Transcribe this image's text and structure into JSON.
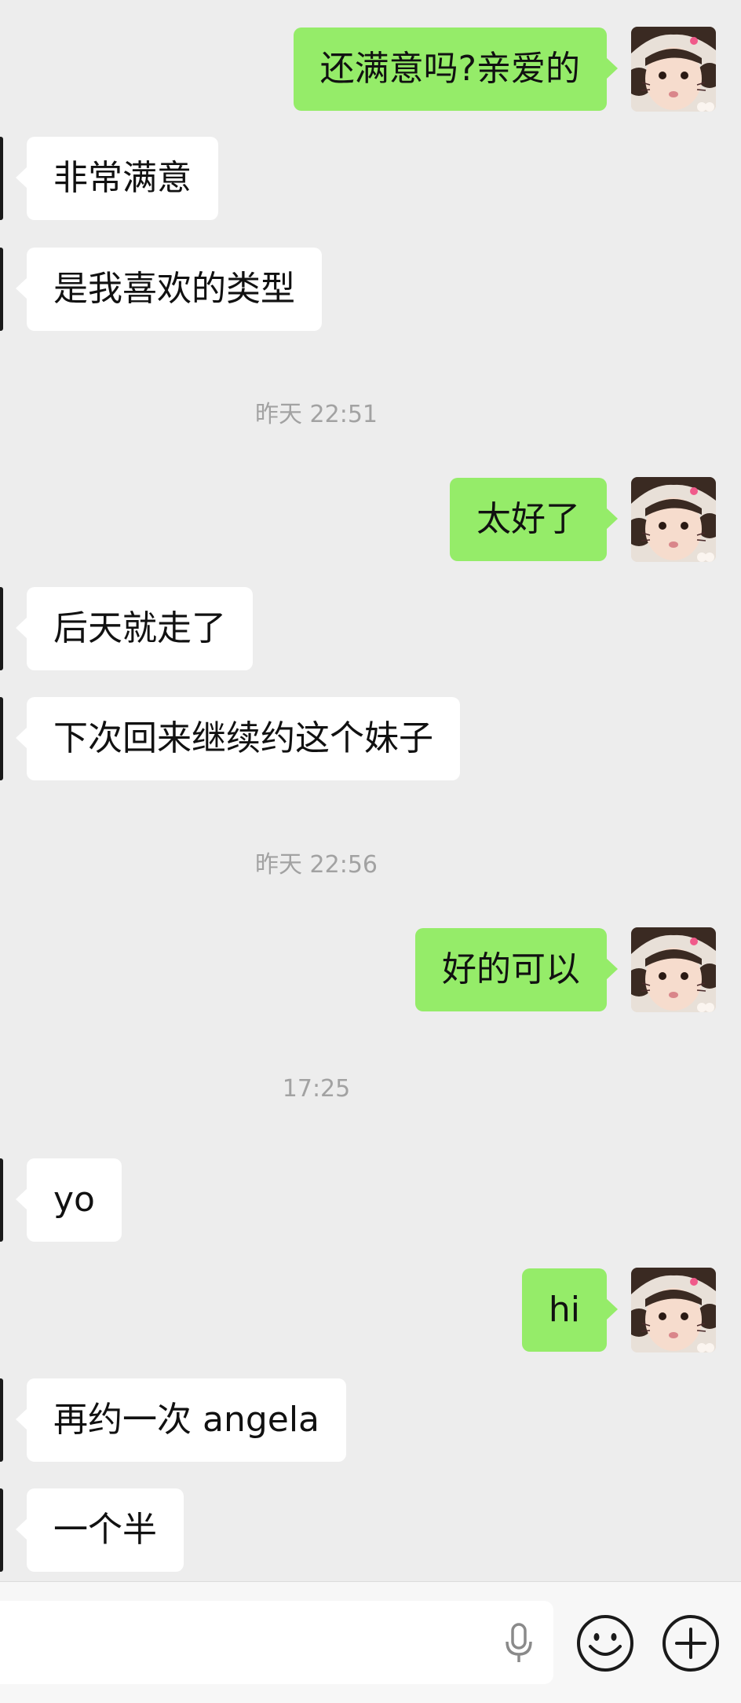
{
  "messages": [
    {
      "side": "out",
      "text": "还满意吗?亲爱的"
    },
    {
      "side": "in",
      "text": "非常满意"
    },
    {
      "side": "in",
      "text": "是我喜欢的类型"
    },
    {
      "side": "time",
      "text": "昨天 22:51"
    },
    {
      "side": "out",
      "text": "太好了"
    },
    {
      "side": "in",
      "text": "后天就走了"
    },
    {
      "side": "in",
      "text": "下次回来继续约这个妹子"
    },
    {
      "side": "time",
      "text": "昨天 22:56"
    },
    {
      "side": "out",
      "text": "好的可以"
    },
    {
      "side": "time",
      "text": "17:25"
    },
    {
      "side": "in",
      "text": "yo"
    },
    {
      "side": "out",
      "text": "hi"
    },
    {
      "side": "in",
      "text": "再约一次 angela"
    },
    {
      "side": "in",
      "text": "一个半"
    }
  ],
  "colors": {
    "outgoing_bubble": "#95ec69",
    "incoming_bubble": "#ffffff",
    "background": "#ededed",
    "timestamp": "#a2a2a2"
  },
  "input_bar": {
    "mic_icon": "microphone-icon",
    "emoji_icon": "emoji-smiley-icon",
    "plus_icon": "plus-circle-icon"
  }
}
